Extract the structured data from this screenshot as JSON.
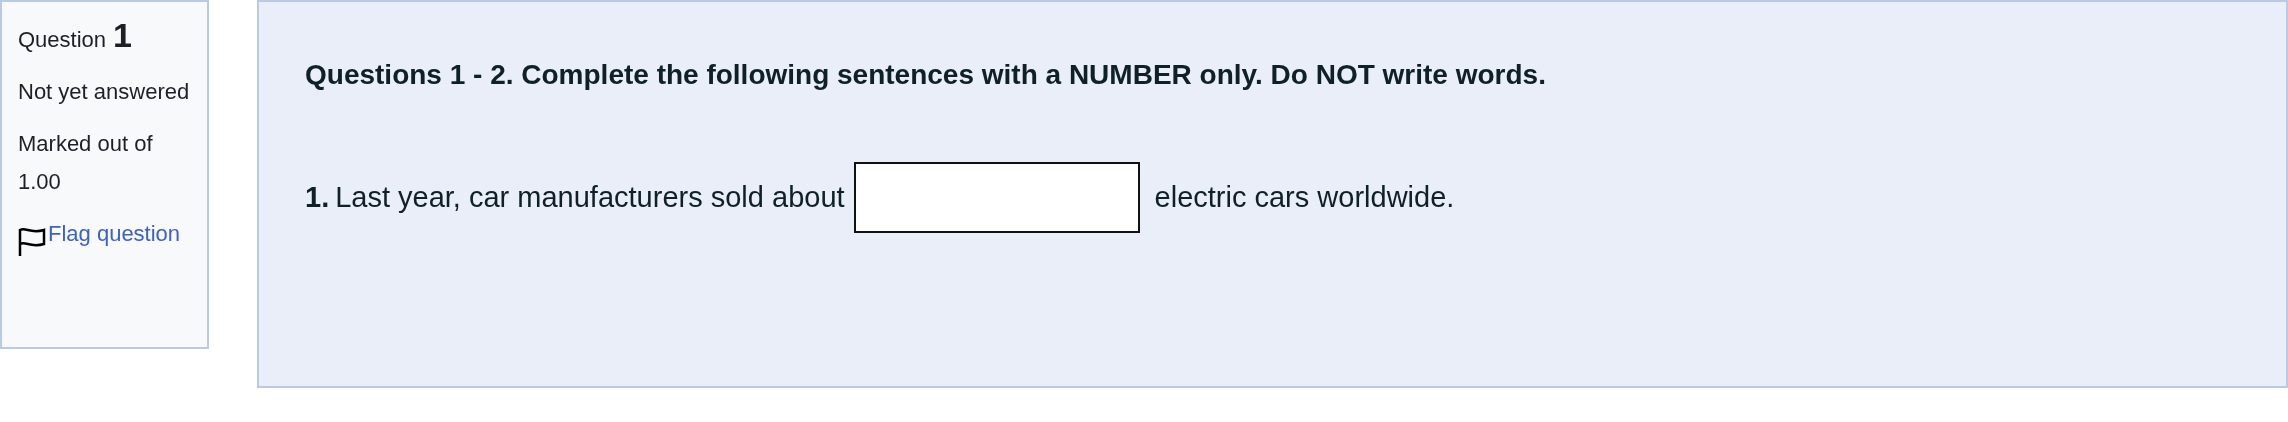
{
  "info": {
    "question_label": "Question",
    "question_number": "1",
    "status": "Not yet answered",
    "marks": "Marked out of 1.00",
    "flag_link": "Flag question"
  },
  "content": {
    "heading": "Questions 1 - 2. Complete the following sentences with a NUMBER only. Do NOT write words.",
    "item": {
      "number": "1.",
      "before": "Last year, car manufacturers sold about",
      "after": "electric cars worldwide."
    }
  }
}
